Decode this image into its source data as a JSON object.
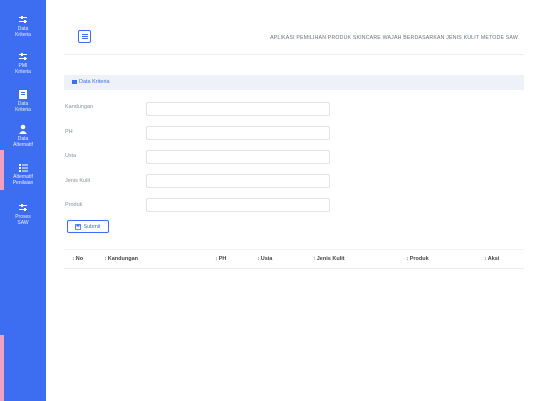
{
  "sidebar": {
    "items": [
      {
        "icon": "sliders-icon",
        "label1": "Data",
        "label2": "Kriteria"
      },
      {
        "icon": "sliders-icon",
        "label1": "PMI",
        "label2": "Kriteria"
      },
      {
        "icon": "clipboard-icon",
        "label1": "Data",
        "label2": "Kriteria"
      },
      {
        "icon": "user-icon",
        "label1": "Data",
        "label2": "Alternatif"
      },
      {
        "icon": "list-icon",
        "label1": "Alternatif",
        "label2": "Penilaian"
      },
      {
        "icon": "sliders-icon",
        "label1": "Proses",
        "label2": "SAW"
      }
    ]
  },
  "header": {
    "title": "APLIKASI PEMILIHAN PRODUK SKINCARE WAJAH BERDASARKAN JENIS KULIT METODE SAW"
  },
  "panel": {
    "title": "Data Kriteria"
  },
  "form": {
    "fields": [
      {
        "label": "Kandungan"
      },
      {
        "label": "PH"
      },
      {
        "label": "Usia"
      },
      {
        "label": "Jenis Kulit"
      },
      {
        "label": "Produk"
      }
    ],
    "submit_label": "Submit"
  },
  "table": {
    "columns": [
      "No",
      "Kandungan",
      "PH",
      "Usia",
      "Jenis Kulit",
      "Produk",
      "Aksi"
    ]
  },
  "colors": {
    "accent": "#3d6df0",
    "panel_bg": "#eef1f7"
  }
}
